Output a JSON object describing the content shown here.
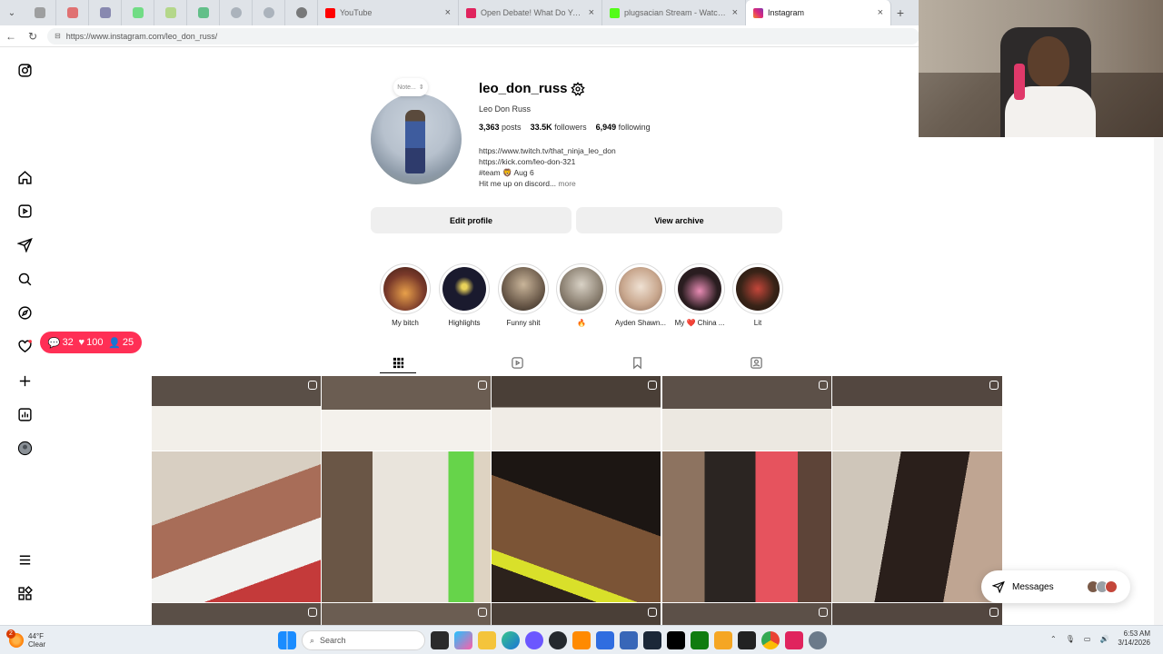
{
  "browser": {
    "tabs": [
      {
        "title": "YouTube",
        "color": "#ff0000"
      },
      {
        "title": "Open Debate! What Do You Belie...",
        "color": "#e0245e"
      },
      {
        "title": "plugsacian Stream - Watch Live on...",
        "color": "#53fc18"
      },
      {
        "title": "Instagram",
        "color": "#d6249f"
      }
    ],
    "url": "https://www.instagram.com/leo_don_russ/"
  },
  "profile": {
    "note": "Note...",
    "username": "leo_don_russ",
    "full_name": "Leo Don Russ",
    "posts_count": "3,363",
    "posts_label": "posts",
    "followers_count": "33.5K",
    "followers_label": "followers",
    "following_count": "6,949",
    "following_label": "following",
    "bio_line1": "https://www.twitch.tv/that_ninja_leo_don",
    "bio_line2": "https://kick.com/leo-don-321",
    "bio_line3": "#team 🦁 Aug 6",
    "bio_line4": "Hit me up on discord...",
    "bio_more": "more",
    "edit_profile": "Edit profile",
    "view_archive": "View archive"
  },
  "highlights": [
    {
      "label": "My bitch",
      "color": "#7a3a2a"
    },
    {
      "label": "Highlights",
      "color": "#1a1a2e"
    },
    {
      "label": "Funny shit",
      "color": "#6b5a4a"
    },
    {
      "label": "🔥",
      "color": "#8a7f70"
    },
    {
      "label": "Ayden Shawn...",
      "color": "#c9a88f"
    },
    {
      "label": "My ❤️ China ...",
      "color": "#2a1d20"
    },
    {
      "label": "Lit",
      "color": "#3a2418"
    }
  ],
  "notifications": {
    "comments": "32",
    "likes": "100",
    "follows": "25"
  },
  "messages": {
    "label": "Messages"
  },
  "taskbar": {
    "weather_temp": "44°F",
    "weather_cond": "Clear",
    "weather_badge": "2",
    "search": "Search",
    "time": "6:53 AM",
    "date": "3/14/2026"
  }
}
